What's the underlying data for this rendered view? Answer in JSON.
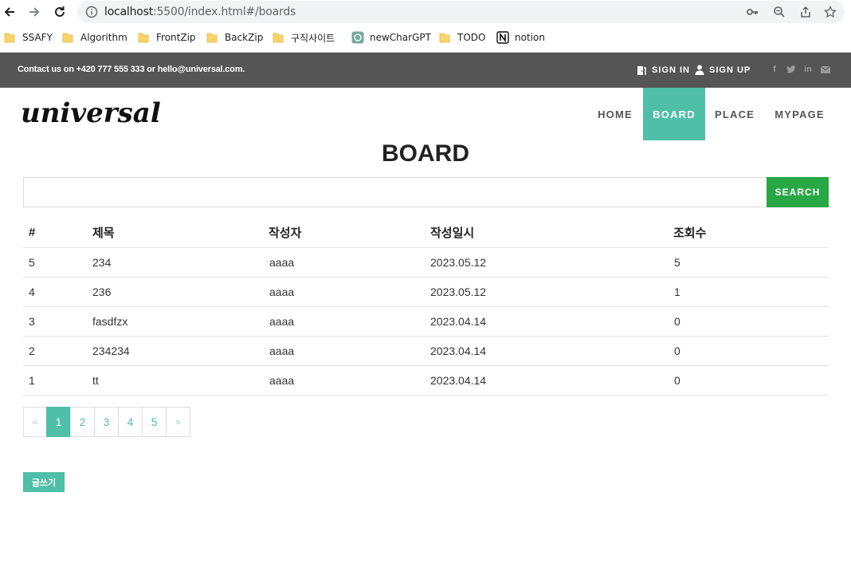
{
  "browser": {
    "url_host": "localhost",
    "url_path": ":5500/index.html#/boards",
    "bookmarks": [
      {
        "label": "SSAFY",
        "icon": "folder-icon"
      },
      {
        "label": "Algorithm",
        "icon": "folder-icon"
      },
      {
        "label": "FrontZip",
        "icon": "folder-icon"
      },
      {
        "label": "BackZip",
        "icon": "folder-icon"
      },
      {
        "label": "구직사이트",
        "icon": "folder-icon"
      },
      {
        "label": "newCharGPT",
        "icon": "chatgpt-icon"
      },
      {
        "label": "TODO",
        "icon": "folder-icon"
      },
      {
        "label": "notion",
        "icon": "notion-icon"
      }
    ]
  },
  "topbar": {
    "contact": "Contact us on +420 777 555 333 or hello@universal.com.",
    "sign_in": "SIGN IN",
    "sign_up": "SIGN UP",
    "social": [
      "facebook-icon",
      "twitter-icon",
      "linkedin-icon",
      "mail-icon"
    ]
  },
  "navbar": {
    "logo": "universal",
    "menu": [
      {
        "label": "HOME",
        "active": false
      },
      {
        "label": "BOARD",
        "active": true
      },
      {
        "label": "PLACE",
        "active": false
      },
      {
        "label": "MYPAGE",
        "active": false
      }
    ]
  },
  "page": {
    "title": "BOARD",
    "search_value": "",
    "search_button": "SEARCH",
    "write_button": "글쓰기"
  },
  "table": {
    "headers": [
      "#",
      "제목",
      "작성자",
      "작성일시",
      "조회수"
    ],
    "rows": [
      [
        "5",
        "234",
        "aaaa",
        "2023.05.12",
        "5"
      ],
      [
        "4",
        "236",
        "aaaa",
        "2023.05.12",
        "1"
      ],
      [
        "3",
        "fasdfzx",
        "aaaa",
        "2023.04.14",
        "0"
      ],
      [
        "2",
        "234234",
        "aaaa",
        "2023.04.14",
        "0"
      ],
      [
        "1",
        "tt",
        "aaaa",
        "2023.04.14",
        "0"
      ]
    ]
  },
  "pagination": {
    "prev": "«",
    "pages": [
      "1",
      "2",
      "3",
      "4",
      "5"
    ],
    "current": "1",
    "next": "»"
  },
  "colors": {
    "accent": "#4fbfa8",
    "search_button": "#28a745",
    "topbar": "#555555"
  }
}
